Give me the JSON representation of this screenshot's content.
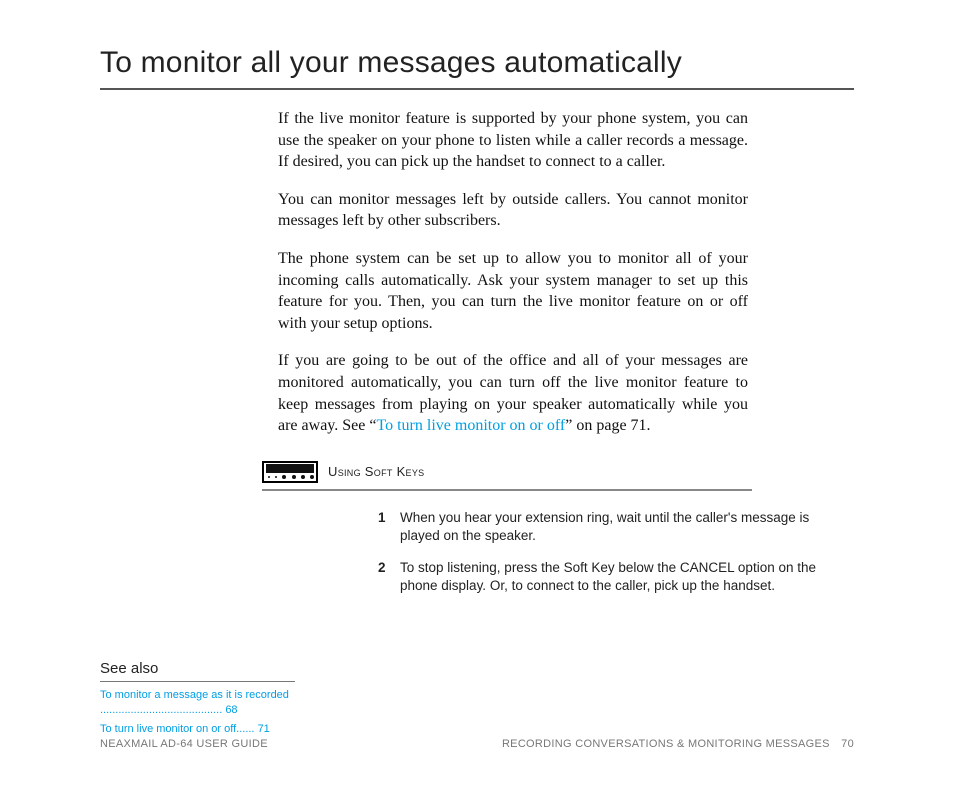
{
  "title": "To monitor all your messages automatically",
  "paragraphs": {
    "p1": "If the live monitor feature is supported by your phone system, you can use the speaker on your phone to listen while a caller records a message. If desired, you can pick up the handset to connect to a caller.",
    "p2": "You can monitor messages left by outside callers. You cannot monitor messages left by other subscribers.",
    "p3": "The phone system can be set up to allow you to monitor all of your incoming calls automatically. Ask your system manager to set up this feature for you. Then, you can turn the live monitor feature on or off with your setup options.",
    "p4_before": "If you are going to be out of the office and all of your messages are monitored automatically, you can turn off the live monitor feature to keep messages from playing on your speaker automatically while you are away. See “",
    "p4_link": "To turn live monitor on or off",
    "p4_after": "” on page 71."
  },
  "soft_keys_label": "Using Soft Keys",
  "steps": [
    "When you hear your extension ring, wait until the caller's message is played on the speaker.",
    "To stop listening, press the Soft Key below the CANCEL option on the phone display. Or, to connect to the caller, pick up the handset."
  ],
  "see_also": {
    "title": "See also",
    "items": [
      {
        "label": "To monitor a message as it is recorded",
        "dots": " ........................................",
        "page": "68"
      },
      {
        "label": "To turn live monitor on or off",
        "dots": "......",
        "page": "71"
      }
    ]
  },
  "footer": {
    "left": "NEAXMAIL AD-64 USER GUIDE",
    "right_section": "RECORDING CONVERSATIONS & MONITORING MESSAGES",
    "page_num": "70"
  }
}
